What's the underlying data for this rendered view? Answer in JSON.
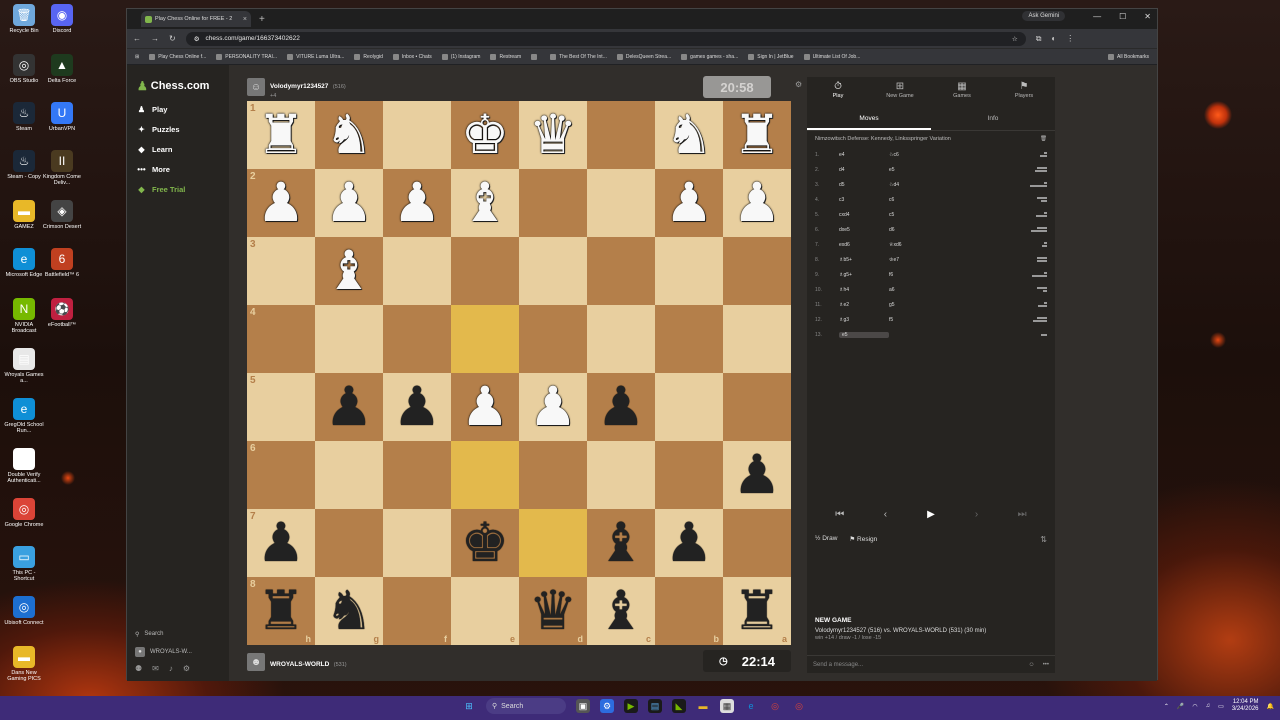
{
  "desktop": {
    "icons": [
      {
        "label": "Recycle Bin",
        "color": "#6fa8dc",
        "glyph": "🗑"
      },
      {
        "label": "Discord",
        "color": "#5865f2",
        "glyph": "◉"
      },
      {
        "label": "OBS Studio",
        "color": "#333333",
        "glyph": "◎"
      },
      {
        "label": "Delta Force",
        "color": "#1e3a1e",
        "glyph": "▲"
      },
      {
        "label": "Steam",
        "color": "#1b2838",
        "glyph": "♨"
      },
      {
        "label": "UrbanVPN",
        "color": "#3478f6",
        "glyph": "U"
      },
      {
        "label": "Steam - Copy",
        "color": "#1b2838",
        "glyph": "♨"
      },
      {
        "label": "Kingdom Come Deliv...",
        "color": "#4a3a20",
        "glyph": "II"
      },
      {
        "label": "GAMEZ",
        "color": "#e8b828",
        "glyph": "▬"
      },
      {
        "label": "Crimson Desert",
        "color": "#444444",
        "glyph": "◈"
      },
      {
        "label": "Microsoft Edge",
        "color": "#0f8fd6",
        "glyph": "e"
      },
      {
        "label": "Battlefield™ 6",
        "color": "#c04020",
        "glyph": "6"
      },
      {
        "label": "NVIDIA Broadcast",
        "color": "#76b900",
        "glyph": "N"
      },
      {
        "label": "eFootball™",
        "color": "#c02040",
        "glyph": "⚽"
      },
      {
        "label": "Wroyals Games a...",
        "color": "#e8e8e8",
        "glyph": "▤"
      },
      {
        "label": "GregOld School Run...",
        "color": "#0f8fd6",
        "glyph": "e"
      },
      {
        "label": "Double Verify Authenticati...",
        "color": "#ffffff",
        "glyph": "▯"
      },
      {
        "label": "Google Chrome",
        "color": "#db4437",
        "glyph": "◎"
      },
      {
        "label": "This PC - Shortcut",
        "color": "#3aa0e0",
        "glyph": "▭"
      },
      {
        "label": "Ubisoft Connect",
        "color": "#1d6fd1",
        "glyph": "◎"
      },
      {
        "label": "Dans New Gaming PICS",
        "color": "#e8b828",
        "glyph": "▬"
      }
    ]
  },
  "browser": {
    "tab_title": "Play Chess Online for FREE - 2",
    "ask_gemini": "Ask Gemini",
    "url": "chess.com/game/166373402622",
    "bookmarks": [
      "Play Chess Online f...",
      "PERSONALITY TRAI...",
      "VITURE Luma Ultra...",
      "Reolygid",
      "Inbox • Chats",
      "(1) Instagram",
      "Restream",
      "",
      "The Best Of The Int...",
      "DelesQueen Strea...",
      "games games - sha...",
      "Sign In | JetBlue",
      "Ultimate List Of Job...",
      "All Bookmarks"
    ]
  },
  "sidebar": {
    "logo": "Chess.com",
    "nav": [
      {
        "label": "Play",
        "glyph": "♟"
      },
      {
        "label": "Puzzles",
        "glyph": "✦"
      },
      {
        "label": "Learn",
        "glyph": "◆"
      },
      {
        "label": "More",
        "glyph": "•••"
      },
      {
        "label": "Free Trial",
        "glyph": "◆"
      }
    ],
    "search": "Search",
    "user": "WROYALS-W..."
  },
  "game": {
    "top_player": {
      "name": "Volodymyr1234527",
      "rating": "(516)",
      "meta": "+4"
    },
    "bottom_player": {
      "name": "WROYALS-WORLD",
      "rating": "(531)"
    },
    "top_clock": "20:58",
    "bottom_clock": "22:14",
    "rank_labels": [
      "1",
      "2",
      "3",
      "4",
      "5",
      "6",
      "7",
      "8"
    ],
    "file_labels": [
      "h",
      "g",
      "f",
      "e",
      "d",
      "c",
      "b",
      "a"
    ],
    "board": [
      [
        "wR",
        "wN",
        "",
        "wK",
        "wQ",
        "",
        "wN",
        "wR"
      ],
      [
        "wP",
        "wP",
        "wP",
        "wB",
        "",
        "",
        "wP",
        "wP"
      ],
      [
        "",
        "wB",
        "",
        "",
        "",
        "",
        "",
        ""
      ],
      [
        "",
        "",
        "",
        "",
        "",
        "",
        "",
        ""
      ],
      [
        "",
        "bP",
        "bP",
        "wP",
        "wP",
        "bP",
        "",
        ""
      ],
      [
        "",
        "",
        "",
        "",
        "",
        "",
        "",
        "bP"
      ],
      [
        "bP",
        "",
        "",
        "bK",
        "",
        "bB",
        "bP",
        ""
      ],
      [
        "bR",
        "bN",
        "",
        "",
        "bQ",
        "bB",
        "",
        "bR"
      ]
    ],
    "highlight_squares": [
      "3-3",
      "5-3",
      "6-4"
    ]
  },
  "panel": {
    "tabs": [
      {
        "label": "Play",
        "glyph": "⏱"
      },
      {
        "label": "New Game",
        "glyph": "⊞"
      },
      {
        "label": "Games",
        "glyph": "▦"
      },
      {
        "label": "Players",
        "glyph": "⚑"
      }
    ],
    "subtabs": [
      "Moves",
      "Info"
    ],
    "opening": "Nimzowitsch Defense: Kennedy, Linksspringer Variation",
    "moves": [
      {
        "n": "1.",
        "w": "e4",
        "b": "♘c6"
      },
      {
        "n": "2.",
        "w": "d4",
        "b": "e5"
      },
      {
        "n": "3.",
        "w": "d5",
        "b": "♘d4"
      },
      {
        "n": "4.",
        "w": "c3",
        "b": "c6"
      },
      {
        "n": "5.",
        "w": "cxd4",
        "b": "c5"
      },
      {
        "n": "6.",
        "w": "dxe5",
        "b": "d6"
      },
      {
        "n": "7.",
        "w": "exd6",
        "b": "♕xd6"
      },
      {
        "n": "8.",
        "w": "♗b5+",
        "b": "♔e7"
      },
      {
        "n": "9.",
        "w": "♗g5+",
        "b": "f6"
      },
      {
        "n": "10.",
        "w": "♗h4",
        "b": "a6"
      },
      {
        "n": "11.",
        "w": "♗e2",
        "b": "g5"
      },
      {
        "n": "12.",
        "w": "♗g3",
        "b": "f5"
      },
      {
        "n": "13.",
        "w": "e5",
        "b": ""
      }
    ],
    "draw": "Draw",
    "resign": "Resign",
    "newgame_title": "NEW GAME",
    "newgame_line": "Volodymyr1234527 (516) vs. WROYALS-WORLD (531) (30 min)",
    "newgame_result": "win +14 / draw -1 / lose -15",
    "chat_placeholder": "Send a message..."
  },
  "taskbar": {
    "search": "Search",
    "time": "12:04 PM",
    "date": "3/24/2026"
  }
}
